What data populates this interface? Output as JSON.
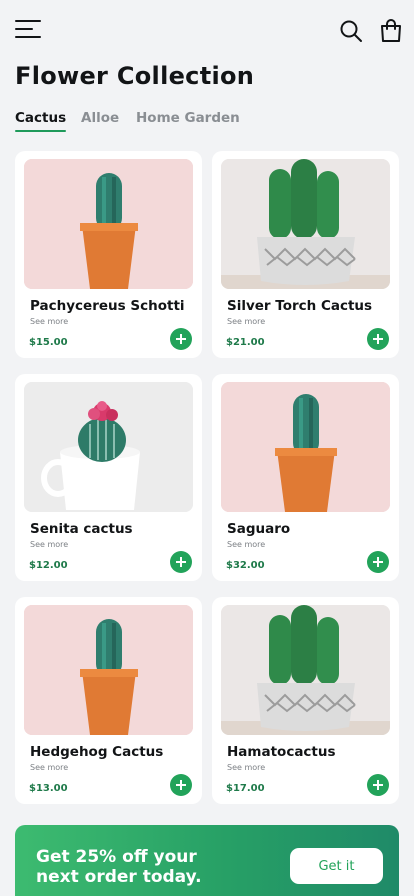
{
  "header": {
    "menu_icon": "hamburger-menu-icon",
    "search_icon": "search-icon",
    "bag_icon": "shopping-bag-icon"
  },
  "page": {
    "title": "Flower Collection"
  },
  "tabs": [
    {
      "label": "Cactus",
      "active": true
    },
    {
      "label": "Alloe",
      "active": false
    },
    {
      "label": "Home Garden",
      "active": false
    }
  ],
  "products": [
    {
      "name": "Pachycereus Schotti",
      "more": "See more",
      "price": "$15.00",
      "photo": "cactus in orange pot"
    },
    {
      "name": "Silver Torch Cactus",
      "more": "See more",
      "price": "$21.00",
      "photo": "cactus in patterned pot"
    },
    {
      "name": "Senita cactus",
      "more": "See more",
      "price": "$12.00",
      "photo": "flowering cactus in white mug"
    },
    {
      "name": "Saguaro",
      "more": "See more",
      "price": "$32.00",
      "photo": "cactus in orange pot"
    },
    {
      "name": "Hedgehog Cactus",
      "more": "See more",
      "price": "$13.00",
      "photo": "cactus in orange pot"
    },
    {
      "name": "Hamatocactus",
      "more": "See more",
      "price": "$17.00",
      "photo": "cactus in patterned pot"
    }
  ],
  "promo": {
    "text": "Get 25% off your next order today.",
    "button": "Get it"
  },
  "colors": {
    "accent": "#22a35a",
    "price": "#1f7a4a",
    "background": "#f2f3f5",
    "card": "#ffffff"
  }
}
